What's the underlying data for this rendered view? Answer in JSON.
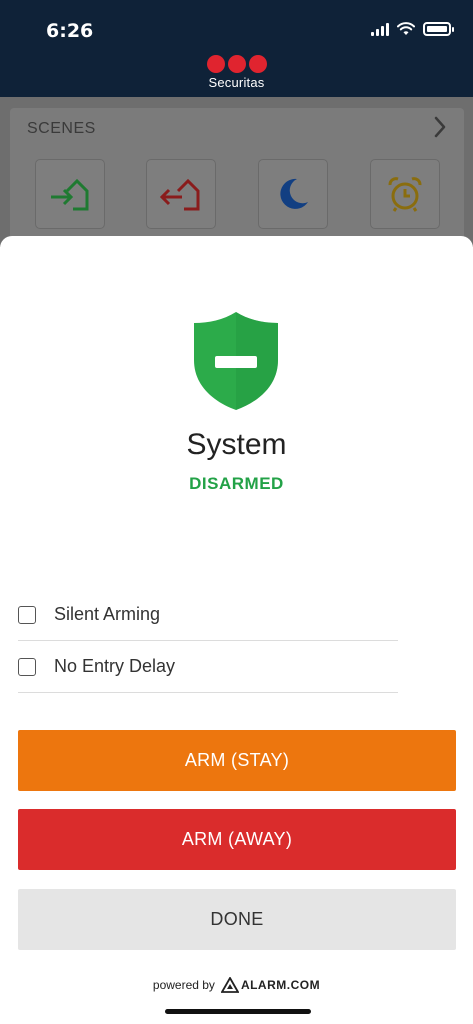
{
  "status_bar": {
    "time": "6:26"
  },
  "brand": {
    "name": "Securitas"
  },
  "scenes": {
    "title": "SCENES",
    "tiles": [
      {
        "icon": "arrive-home-icon",
        "color": "#2a9a3e"
      },
      {
        "icon": "leave-home-icon",
        "color": "#c93030"
      },
      {
        "icon": "moon-icon",
        "color": "#1e6fd9"
      },
      {
        "icon": "alarm-clock-icon",
        "color": "#e5b81a"
      }
    ]
  },
  "system": {
    "title": "System",
    "status": "DISARMED",
    "status_color": "#23a247",
    "shield_color": "#2cab4a"
  },
  "options": [
    {
      "label": "Silent Arming",
      "checked": false
    },
    {
      "label": "No Entry Delay",
      "checked": false
    }
  ],
  "buttons": {
    "arm_stay": "ARM (STAY)",
    "arm_away": "ARM (AWAY)",
    "done": "DONE"
  },
  "footer": {
    "powered_by": "powered by",
    "provider": "ALARM.COM"
  }
}
